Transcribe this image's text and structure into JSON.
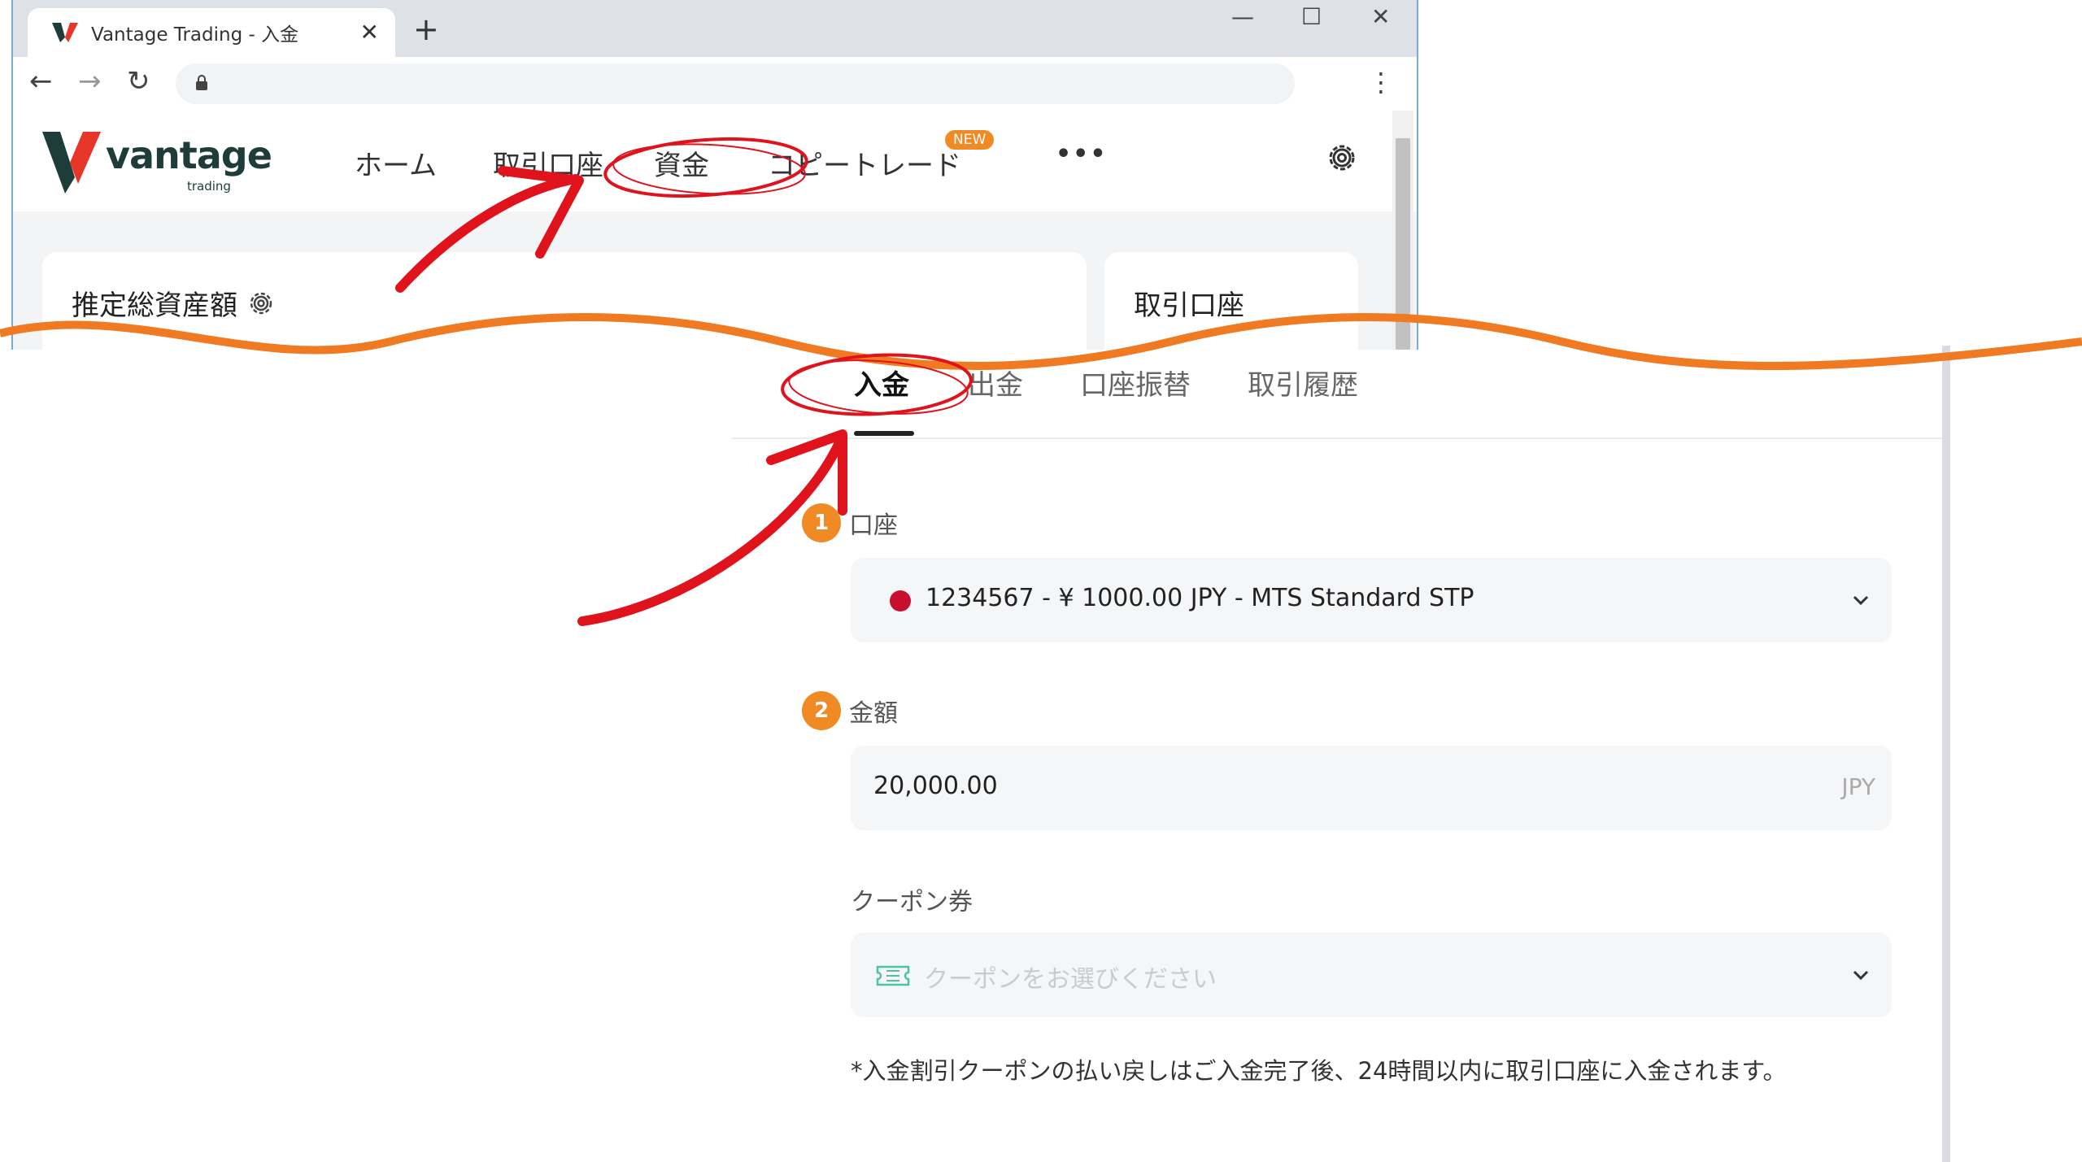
{
  "browser": {
    "tab_title": "Vantage Trading - 入金",
    "close_glyph": "✕",
    "newtab_glyph": "+",
    "minimize_glyph": "—",
    "maximize_glyph": "☐",
    "window_close_glyph": "✕",
    "back_glyph": "←",
    "forward_glyph": "→",
    "reload_glyph": "↻",
    "menu_glyph": "⋮"
  },
  "app": {
    "logo_word": "vantage",
    "logo_sub": "trading",
    "nav": {
      "home": "ホーム",
      "accounts": "取引口座",
      "funds": "資金",
      "copytrade": "コピートレード",
      "new_badge": "NEW",
      "more": "•••"
    },
    "card_total_assets": "推定総資産額",
    "card_accounts": "取引口座"
  },
  "funds_tabs": {
    "deposit": "入金",
    "withdraw": "出金",
    "transfer": "口座振替",
    "history": "取引履歴"
  },
  "form": {
    "step1_num": "1",
    "step1_label": "口座",
    "account_value": "1234567 - ¥ 1000.00 JPY - MTS Standard STP",
    "step2_num": "2",
    "step2_label": "金額",
    "amount_value": "20,000.00",
    "amount_currency": "JPY",
    "coupon_label": "クーポン券",
    "coupon_placeholder": "クーポンをお選びください",
    "note": "*入金割引クーポンの払い戻しはご入金完了後、24時間以内に取引口座に入金されます。"
  },
  "colors": {
    "accent_orange": "#f08a24",
    "annotation_red": "#e0131d",
    "wave_orange": "#f07a22",
    "brand_red": "#e8352a",
    "brand_dark": "#1d3c3a"
  }
}
